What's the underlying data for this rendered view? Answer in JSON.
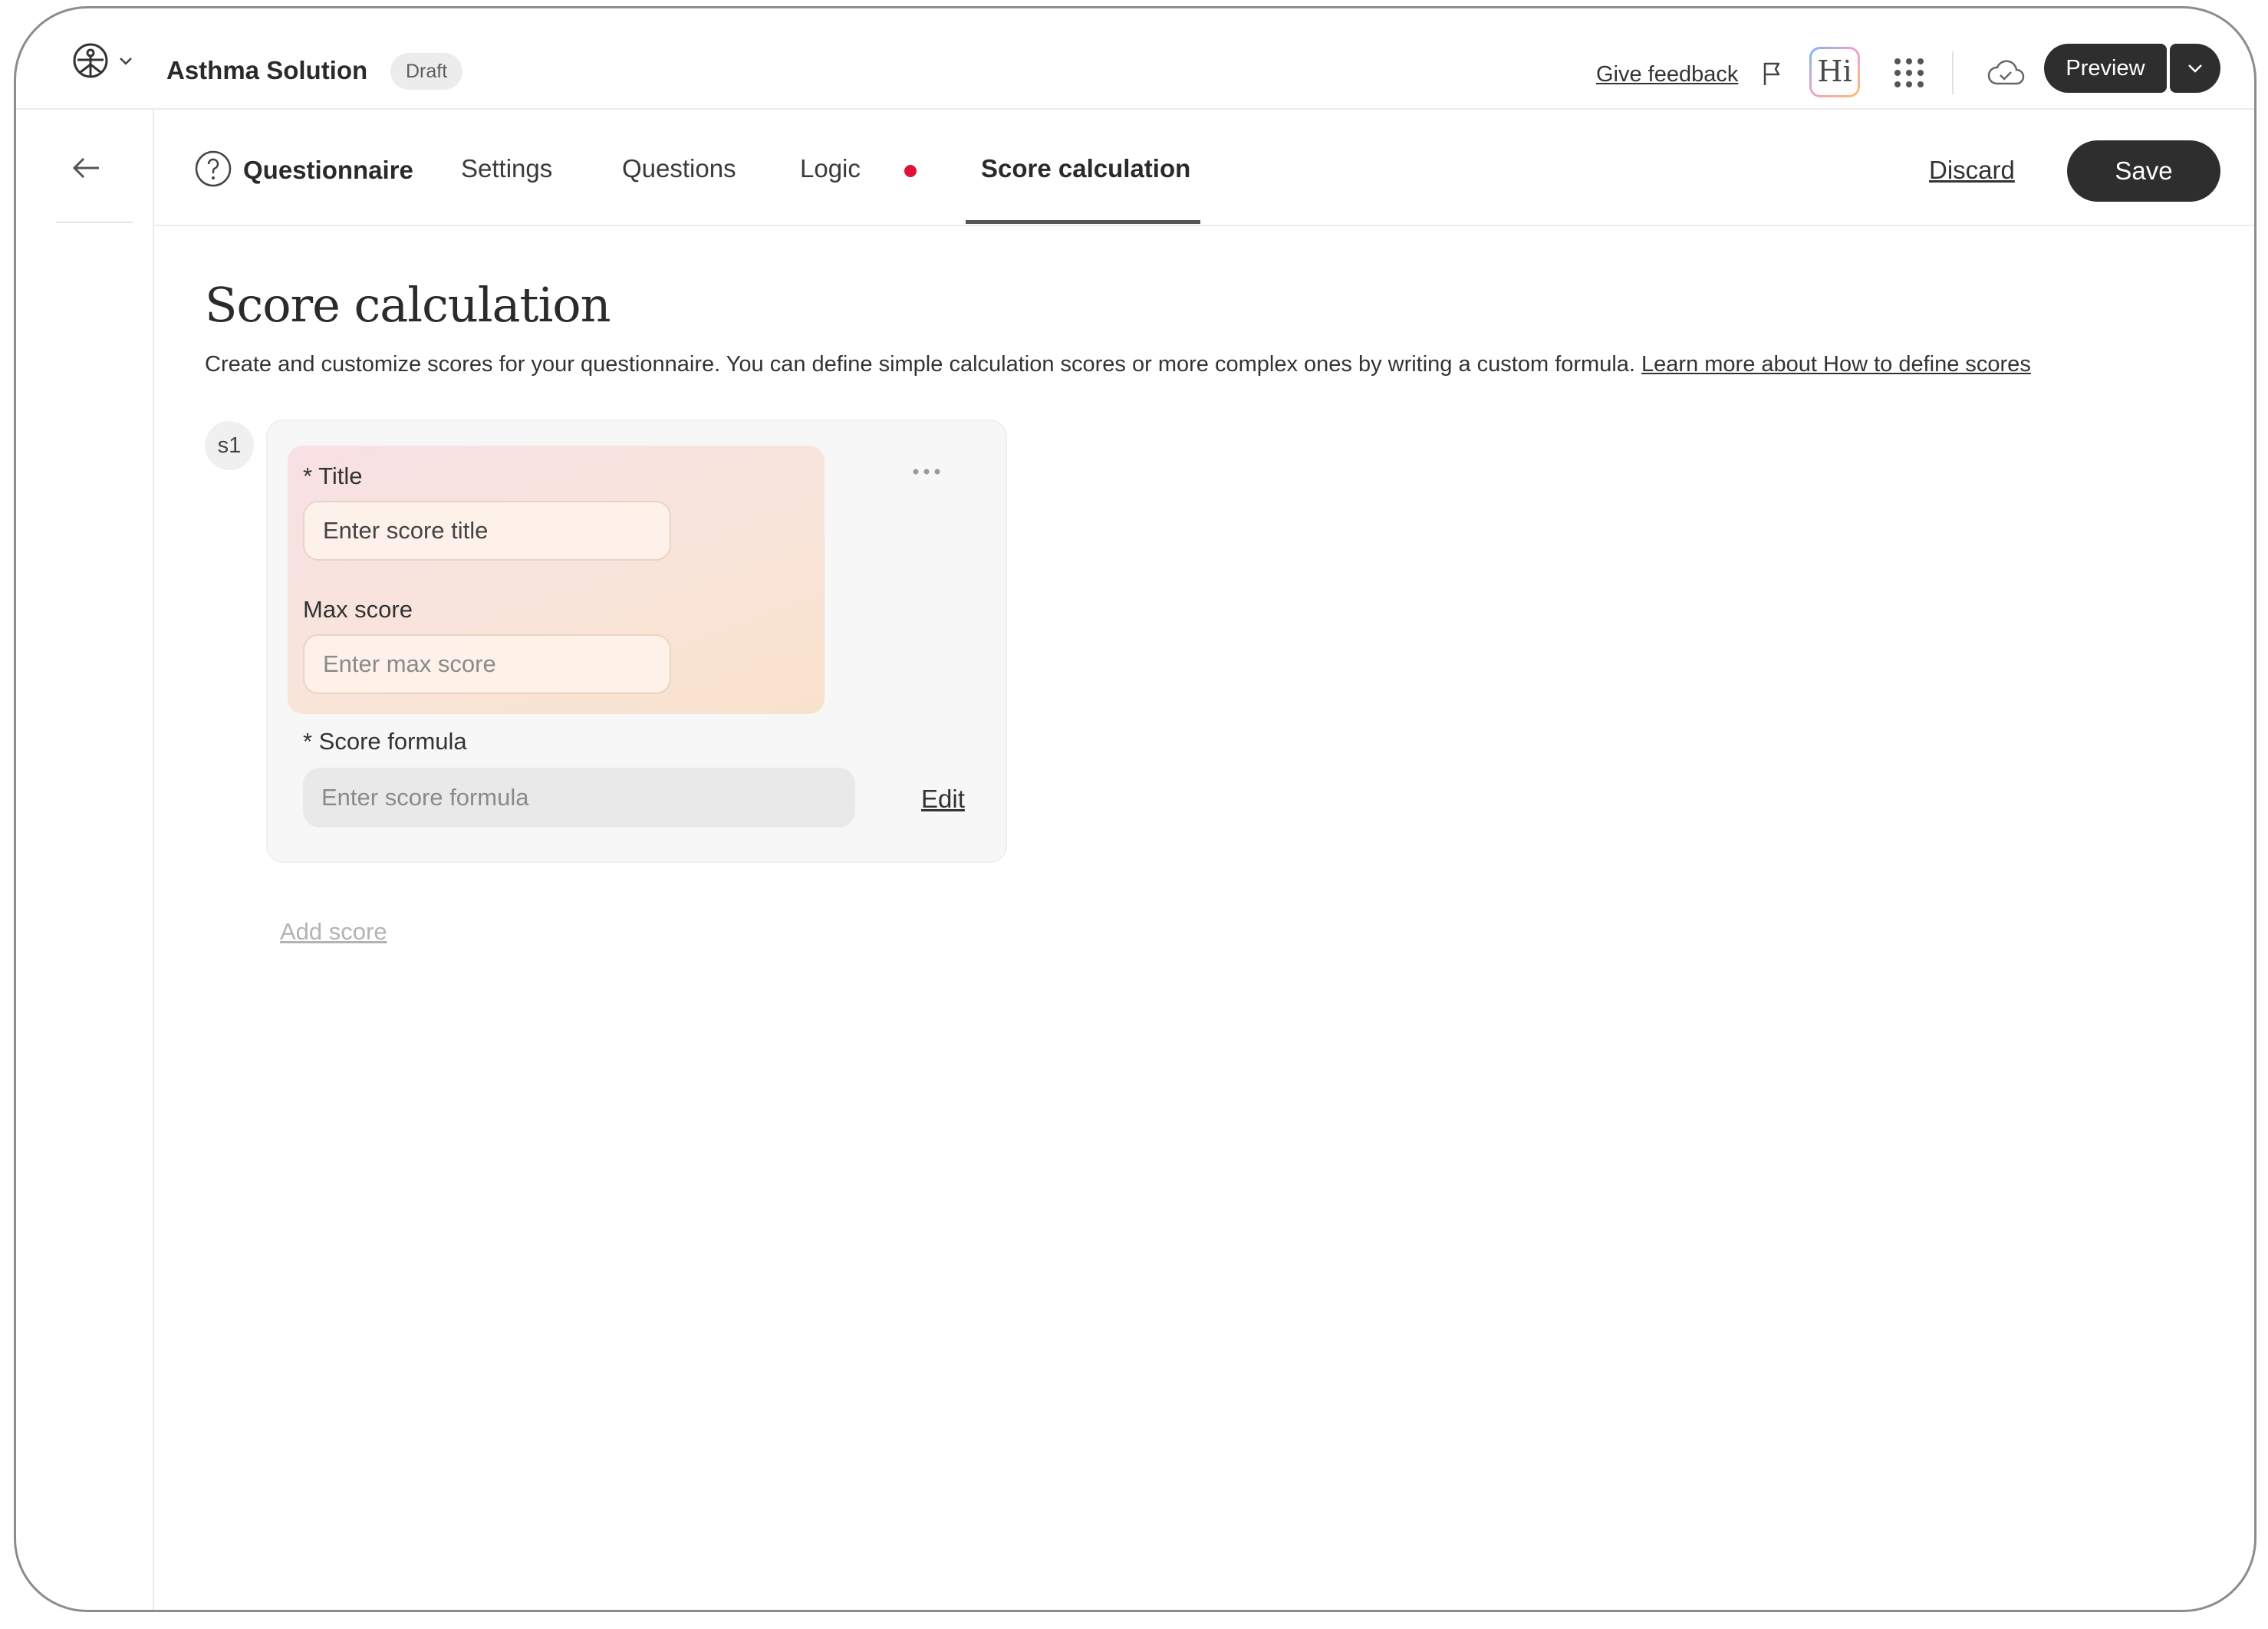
{
  "header": {
    "app_title": "Asthma Solution",
    "status_badge": "Draft",
    "give_feedback": "Give feedback",
    "hi_label": "Hi",
    "preview_label": "Preview"
  },
  "tabs": {
    "questionnaire": "Questionnaire",
    "settings": "Settings",
    "questions": "Questions",
    "logic": "Logic",
    "score_calculation": "Score calculation",
    "active": "score_calculation",
    "logic_indicator_color": "#e0123a"
  },
  "actions": {
    "discard": "Discard",
    "save": "Save"
  },
  "main": {
    "title": "Score calculation",
    "description": "Create and customize scores for your questionnaire. You can define simple calculation scores or more complex ones by writing a custom formula.",
    "learn_more": "Learn more about How to define scores"
  },
  "scores": [
    {
      "id": "s1",
      "title_label": "* Title",
      "title_placeholder": "Enter score title",
      "max_label": "Max score",
      "max_placeholder": "Enter max score",
      "formula_label": "* Score formula",
      "formula_placeholder": "Enter score formula",
      "edit_label": "Edit"
    }
  ],
  "add_score": "Add score",
  "icons": {
    "logo": "logo-icon",
    "flag": "flag-icon",
    "apps": "grid-icon",
    "cloud": "cloud-check-icon",
    "back": "arrow-left-icon",
    "help": "question-circle-icon",
    "more": "more-horizontal-icon"
  },
  "colors": {
    "primary_button": "#2e2e2e",
    "accent_dot": "#e0123a"
  }
}
